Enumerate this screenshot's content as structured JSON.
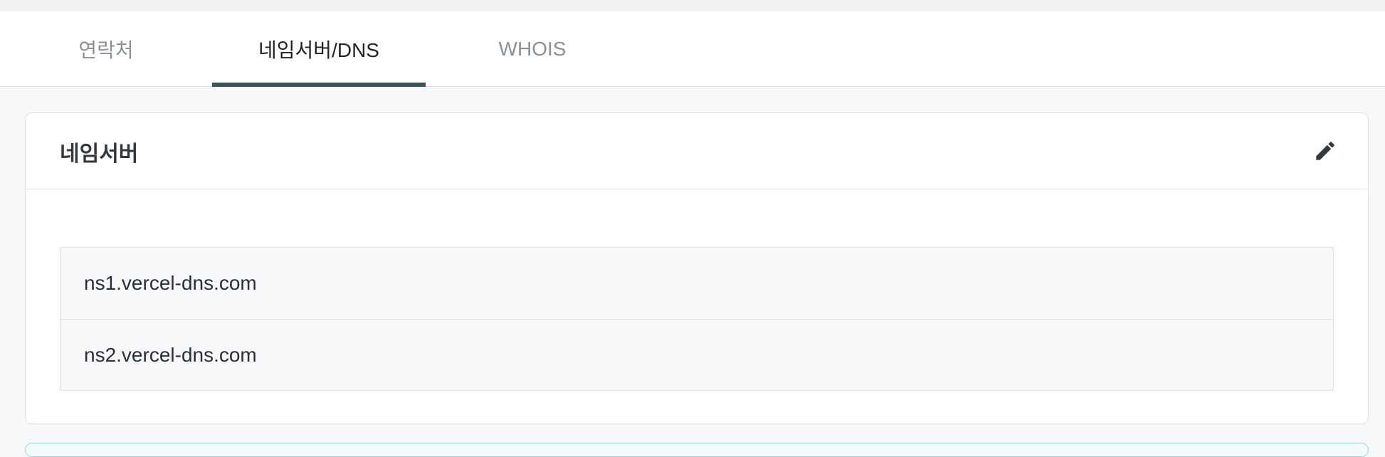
{
  "tabs": [
    {
      "label": "연락처",
      "active": false
    },
    {
      "label": "네임서버/DNS",
      "active": true
    },
    {
      "label": "WHOIS",
      "active": false
    }
  ],
  "nameserver_card": {
    "title": "네임서버",
    "edit_icon": "pencil-icon",
    "nameservers": [
      "ns1.vercel-dns.com",
      "ns2.vercel-dns.com"
    ]
  },
  "colors": {
    "active_tab_underline": "#3d5257",
    "page_background": "#f7f8fa",
    "next_card_border": "#9ed6dc"
  }
}
